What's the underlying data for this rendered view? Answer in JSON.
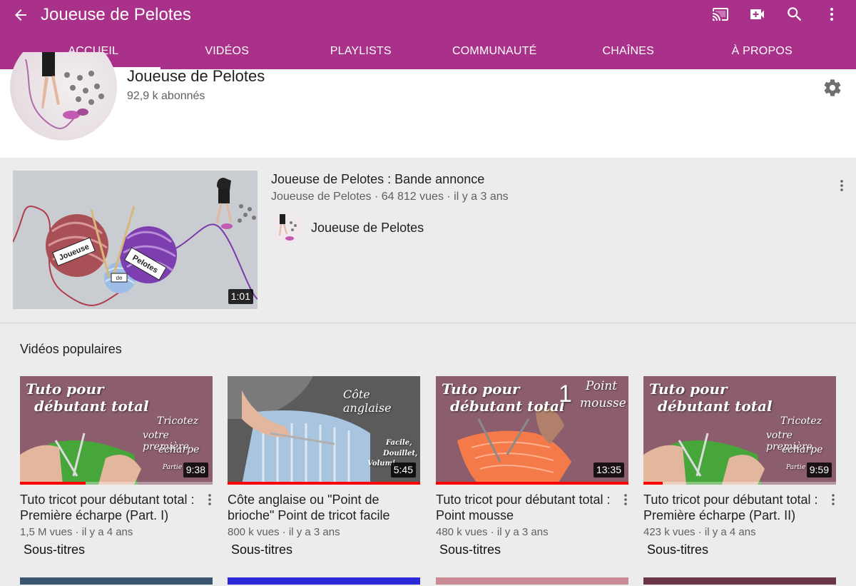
{
  "appbar": {
    "title": "Joueuse de Pelotes",
    "back_icon": "arrow-left-icon",
    "actions": [
      "cast-icon",
      "video-add-icon",
      "search-icon",
      "more-vertical-icon"
    ],
    "color": "#a9318a"
  },
  "tabs": [
    {
      "label": "ACCUEIL",
      "active": true
    },
    {
      "label": "VIDÉOS",
      "active": false
    },
    {
      "label": "PLAYLISTS",
      "active": false
    },
    {
      "label": "COMMUNAUTÉ",
      "active": false
    },
    {
      "label": "CHAÎNES",
      "active": false
    },
    {
      "label": "À PROPOS",
      "active": false
    }
  ],
  "channel": {
    "name": "Joueuse de Pelotes",
    "subscribers": "92,9 k abonnés"
  },
  "featured": {
    "title": "Joueuse de Pelotes : Bande annonce",
    "meta": "Joueuse de Pelotes · 64 812 vues · il y a 3 ans",
    "channel_label": "Joueuse de Pelotes",
    "duration": "1:01",
    "thumb_labels": {
      "left": "Joueuse",
      "middle": "de",
      "right": "Pelotes"
    }
  },
  "popular": {
    "title": "Vidéos populaires",
    "videos": [
      {
        "title": "Tuto tricot pour débutant total : Première écharpe (Part. I)",
        "meta": "1,5 M vues · il y a 4 ans",
        "captions": "Sous-titres",
        "duration": "9:38",
        "progress": 0.34,
        "thumb": {
          "line1": "Tuto pour",
          "line2": "débutant total",
          "side1": "Tricotez",
          "side2": "votre première",
          "side3": "écharpe",
          "tag": "Partie"
        }
      },
      {
        "title": "Côte anglaise ou \"Point de brioche\" Point de tricot facile",
        "meta": "800 k vues · il y a 3 ans",
        "captions": "Sous-titres",
        "duration": "5:45",
        "progress": 1.0,
        "thumb": {
          "line1": "Côte anglaise",
          "side1": "Facile,",
          "side2": "Douillet,",
          "side3": "Volumi"
        }
      },
      {
        "title": "Tuto tricot pour débutant total : Point mousse",
        "meta": "480 k vues · il y a 3 ans",
        "captions": "Sous-titres",
        "duration": "13:35",
        "progress": 1.0,
        "thumb": {
          "line1": "Tuto pour",
          "line2": "débutant total",
          "number": "1",
          "side1": "Point",
          "side2": "mousse"
        }
      },
      {
        "title": "Tuto tricot pour débutant total : Première écharpe (Part. II)",
        "meta": "423 k vues · il y a 4 ans",
        "captions": "Sous-titres",
        "duration": "9:59",
        "progress": 0.1,
        "thumb": {
          "line1": "Tuto pour",
          "line2": "débutant total",
          "side1": "Tricotez",
          "side2": "votre première",
          "side3": "écharpe",
          "tag": "Partie"
        }
      }
    ]
  },
  "colors": {
    "accent": "#a9318a",
    "progress": "#ff0000"
  }
}
